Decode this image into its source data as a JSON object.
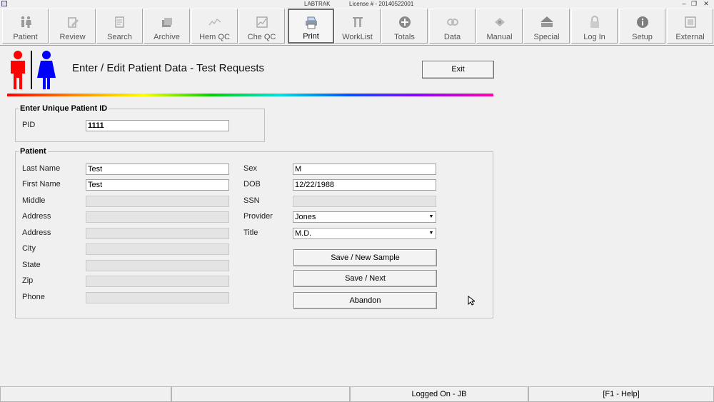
{
  "window": {
    "title": "LABTRAK",
    "license": "License # - 20140522001",
    "minimize": "–",
    "restore": "❐",
    "close": "✕"
  },
  "toolbar": [
    {
      "id": "patient",
      "label": "Patient",
      "icon": "patient-icon",
      "active": false
    },
    {
      "id": "review",
      "label": "Review",
      "icon": "review-icon",
      "active": false
    },
    {
      "id": "search",
      "label": "Search",
      "icon": "search-icon",
      "active": false
    },
    {
      "id": "archive",
      "label": "Archive",
      "icon": "archive-icon",
      "active": false
    },
    {
      "id": "hemqc",
      "label": "Hem QC",
      "icon": "hem-qc-icon",
      "active": false
    },
    {
      "id": "cheqc",
      "label": "Che QC",
      "icon": "che-qc-icon",
      "active": false
    },
    {
      "id": "print",
      "label": "Print",
      "icon": "print-icon",
      "active": true
    },
    {
      "id": "worklist",
      "label": "WorkList",
      "icon": "worklist-icon",
      "active": false
    },
    {
      "id": "totals",
      "label": "Totals",
      "icon": "totals-icon",
      "active": false
    },
    {
      "id": "data",
      "label": "Data",
      "icon": "data-icon",
      "active": false
    },
    {
      "id": "manual",
      "label": "Manual",
      "icon": "manual-icon",
      "active": false
    },
    {
      "id": "special",
      "label": "Special",
      "icon": "special-icon",
      "active": false
    },
    {
      "id": "login",
      "label": "Log In",
      "icon": "lock-icon",
      "active": false
    },
    {
      "id": "setup",
      "label": "Setup",
      "icon": "info-icon",
      "active": false
    },
    {
      "id": "external",
      "label": "External",
      "icon": "external-icon",
      "active": false
    }
  ],
  "header": {
    "title": "Enter / Edit Patient Data - Test Requests",
    "exit_label": "Exit"
  },
  "colors": {
    "logo_male": "#ff0000",
    "logo_female": "#0000ff"
  },
  "pid_group": {
    "legend": "Enter Unique Patient ID",
    "pid_label": "PID",
    "pid_value": "1111"
  },
  "patient": {
    "legend": "Patient",
    "last_name": {
      "label": "Last Name",
      "value": "Test"
    },
    "first_name": {
      "label": "First Name",
      "value": "Test"
    },
    "middle": {
      "label": "Middle",
      "value": ""
    },
    "address1": {
      "label": "Address",
      "value": ""
    },
    "address2": {
      "label": "Address",
      "value": ""
    },
    "city": {
      "label": "City",
      "value": ""
    },
    "state": {
      "label": "State",
      "value": ""
    },
    "zip": {
      "label": "Zip",
      "value": ""
    },
    "phone": {
      "label": "Phone",
      "value": ""
    },
    "sex": {
      "label": "Sex",
      "value": "M"
    },
    "dob": {
      "label": "DOB",
      "value": "12/22/1988"
    },
    "ssn": {
      "label": "SSN",
      "value": ""
    },
    "provider": {
      "label": "Provider",
      "value": "Jones"
    },
    "title": {
      "label": "Title",
      "value": "M.D."
    }
  },
  "buttons": {
    "save_new": "Save / New Sample",
    "save_next": "Save / Next",
    "abandon": "Abandon"
  },
  "status": {
    "s1": "",
    "s2": "",
    "logged_on": "Logged On - JB",
    "help": "[F1 - Help]"
  }
}
